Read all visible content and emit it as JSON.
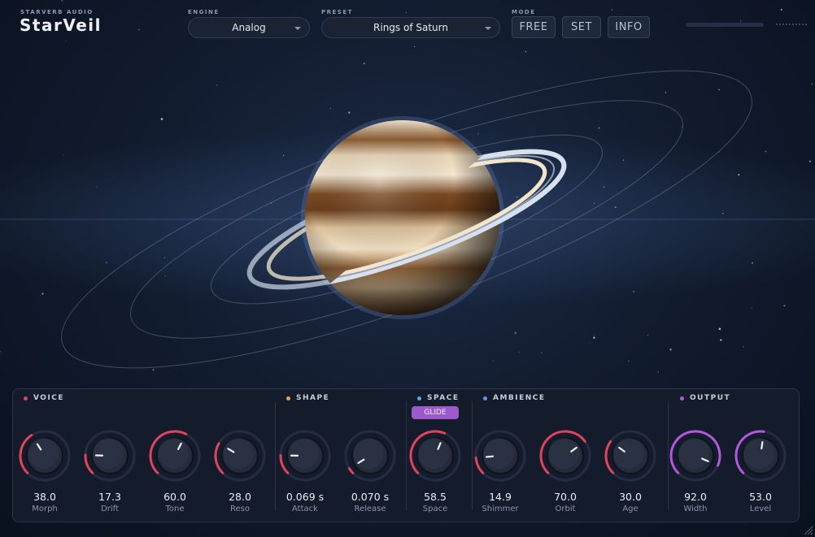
{
  "brand": {
    "company": "STARVERB AUDIO",
    "name": "StarVeil"
  },
  "engine": {
    "label": "ENGINE",
    "value": "Analog"
  },
  "preset": {
    "label": "PRESET",
    "value": "Rings of Saturn"
  },
  "mode": {
    "label": "MODE",
    "buttons": [
      "FREE",
      "SET",
      "INFO"
    ]
  },
  "colors": {
    "voice": "#e0435a",
    "shape": "#e8a24a",
    "space": "#5aa9e8",
    "ambience": "#5a9ae8",
    "output": "#b257e0",
    "accent": "#9b59c9"
  },
  "sections": [
    {
      "title": "VOICE"
    },
    {
      "title": "SHAPE"
    },
    {
      "title": "SPACE"
    },
    {
      "title": "AMBIENCE"
    },
    {
      "title": "OUTPUT"
    }
  ],
  "glide": "GLIDE",
  "knobs": [
    {
      "value": "38.0",
      "label": "Morph",
      "level": 0.38,
      "ring": "voice"
    },
    {
      "value": "17.3",
      "label": "Drift",
      "level": 0.173,
      "ring": "voice"
    },
    {
      "value": "60.0",
      "label": "Tone",
      "level": 0.6,
      "ring": "voice"
    },
    {
      "value": "28.0",
      "label": "Reso",
      "level": 0.28,
      "ring": "voice"
    },
    {
      "value": "0.069 s",
      "label": "Attack",
      "level": 0.17,
      "ring": "voice"
    },
    {
      "value": "0.070 s",
      "label": "Release",
      "level": 0.05,
      "ring": "voice"
    },
    {
      "value": "58.5",
      "label": "Space",
      "level": 0.585,
      "ring": "voice"
    },
    {
      "value": "14.9",
      "label": "Shimmer",
      "level": 0.149,
      "ring": "voice"
    },
    {
      "value": "70.0",
      "label": "Orbit",
      "level": 0.7,
      "ring": "voice"
    },
    {
      "value": "30.0",
      "label": "Age",
      "level": 0.3,
      "ring": "voice"
    },
    {
      "value": "92.0",
      "label": "Width",
      "level": 0.92,
      "ring": "output"
    },
    {
      "value": "53.0",
      "label": "Level",
      "level": 0.53,
      "ring": "output"
    }
  ]
}
